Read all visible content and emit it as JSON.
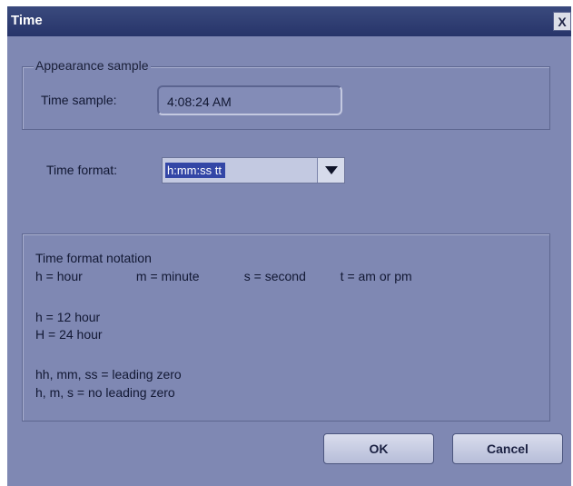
{
  "window": {
    "title": "Time",
    "close_glyph": "X"
  },
  "appearance": {
    "legend": "Appearance sample",
    "time_sample_label": "Time sample:",
    "time_sample_value": "4:08:24 AM"
  },
  "format": {
    "label": "Time format:",
    "selected": "h:mm:ss tt",
    "arrow_icon": "dropdown-arrow-icon"
  },
  "notation": {
    "heading": "Time format notation",
    "units": [
      "h = hour",
      "m = minute",
      "s = second",
      "t = am or pm"
    ],
    "hour12": "h = 12 hour",
    "hour24": "H = 24 hour",
    "leading": "hh, mm, ss = leading zero",
    "no_leading": "h, m, s = no leading zero"
  },
  "buttons": {
    "ok": "OK",
    "cancel": "Cancel"
  },
  "colors": {
    "dialog_bg": "#7f88b3",
    "titlebar": "#27346a",
    "selection": "#3346a6"
  }
}
